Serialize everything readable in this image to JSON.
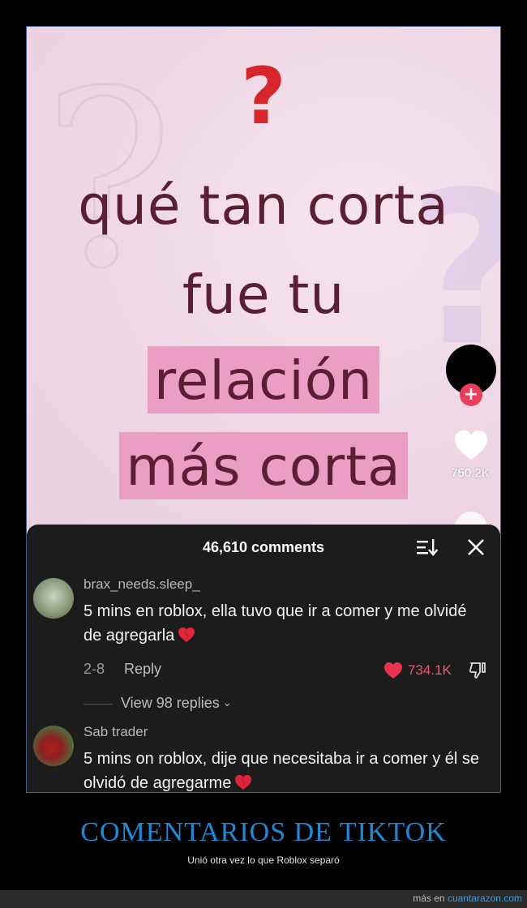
{
  "video": {
    "question_mark": "?",
    "line1": "qué tan corta",
    "line2": "fue tu",
    "line3": "relación",
    "line4": "más corta",
    "likes": "750.2K",
    "follow_symbol": "+"
  },
  "comments_sheet": {
    "title": "46,610 comments",
    "comments": [
      {
        "username": "brax_needs.sleep_",
        "text": "5 mins en roblox, ella tuvo que ir a comer y me olvidé de agregarla",
        "date": "2-8",
        "reply_label": "Reply",
        "likes": "734.1K",
        "view_replies": "View 98 replies"
      },
      {
        "username": "Sab trader",
        "text": "5 mins on roblox, dije que necesitaba ir a comer y él se olvidó de agregarme"
      }
    ]
  },
  "caption": {
    "title": "COMENTARIOS DE TIKTOK",
    "subtitle": "Unió otra vez lo que Roblox separó"
  },
  "footer": {
    "prefix": "más en",
    "site": "cuantarazon.com"
  },
  "colors": {
    "accent_red": "#d6262b",
    "highlight_pink": "#ea9ec4",
    "caption_blue": "#1e8ad6",
    "like_red": "#e85a74"
  }
}
